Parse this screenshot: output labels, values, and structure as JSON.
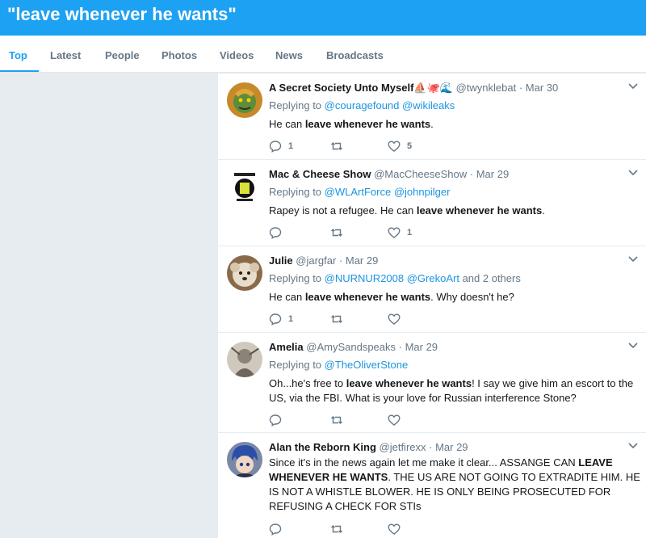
{
  "search": {
    "query": "\"leave whenever he wants\""
  },
  "tabs": [
    {
      "label": "Top"
    },
    {
      "label": "Latest"
    },
    {
      "label": "People"
    },
    {
      "label": "Photos"
    },
    {
      "label": "Videos"
    },
    {
      "label": "News"
    },
    {
      "label": "Broadcasts"
    }
  ],
  "tweets": [
    {
      "name": "A Secret Society Unto Myself",
      "name_emoji": "⛵🐙🌊",
      "handle": "@twynklebat",
      "date": "· Mar 30",
      "reply_prefix": "Replying to",
      "reply_to": "@couragefound @wikileaks",
      "text_parts": [
        "He can ",
        "leave whenever he wants",
        "."
      ],
      "replies": "1",
      "retweets": "",
      "likes": "5"
    },
    {
      "name": "Mac & Cheese Show",
      "handle": "@MacCheeseShow",
      "date": "· Mar 29",
      "reply_prefix": "Replying to",
      "reply_to": "@WLArtForce @johnpilger",
      "text_parts": [
        "Rapey is not a refugee. He  can ",
        "leave whenever he wants",
        "."
      ],
      "replies": "",
      "retweets": "",
      "likes": "1"
    },
    {
      "name": "Julie",
      "handle": "@jargfar",
      "date": "· Mar 29",
      "reply_prefix": "Replying to",
      "reply_to": "@NURNUR2008 @GrekoArt",
      "reply_suffix": " and 2 others",
      "text_parts": [
        "He can ",
        "leave whenever he wants",
        ". Why doesn't he?"
      ],
      "replies": "1",
      "retweets": "",
      "likes": ""
    },
    {
      "name": "Amelia",
      "handle": "@AmySandspeaks",
      "date": "· Mar 29",
      "reply_prefix": "Replying to",
      "reply_to": "@TheOliverStone",
      "text_parts": [
        "Oh...he's free to ",
        "leave whenever he wants",
        "!  I say we give him an escort to the US, via the FBI.  What is your love for Russian interference Stone?"
      ],
      "replies": "",
      "retweets": "",
      "likes": ""
    },
    {
      "name": "Alan the Reborn King",
      "handle": "@jetfirexx",
      "date": "· Mar 29",
      "text_parts": [
        "Since it's in the news again let me make it clear... ASSANGE CAN ",
        "LEAVE WHENEVER HE WANTS",
        ". THE US ARE NOT GOING TO EXTRADITE HIM. HE IS NOT A WHISTLE BLOWER. HE IS ONLY BEING PROSECUTED FOR REFUSING A CHECK FOR STIs"
      ],
      "replies": "",
      "retweets": "",
      "likes": ""
    }
  ],
  "colors": {
    "brand": "#1da1f2",
    "link": "#1b95e0",
    "muted": "#657786",
    "background": "#e6ecf0"
  }
}
